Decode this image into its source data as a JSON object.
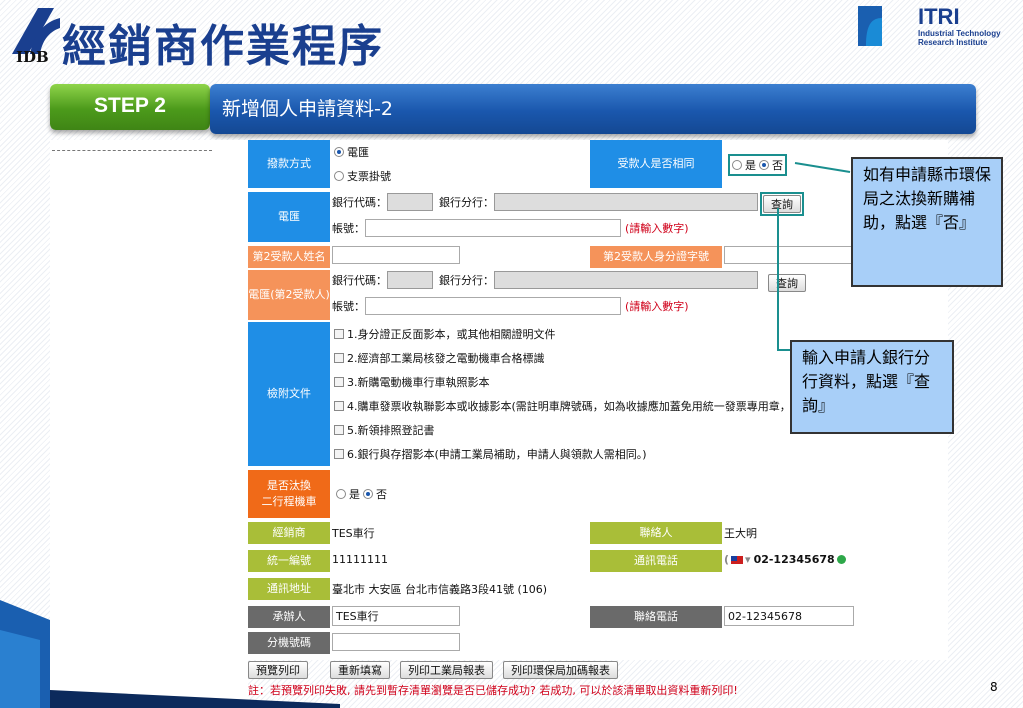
{
  "slide": {
    "title": "經銷商作業程序",
    "idb": "IDB",
    "itri_name": "ITRI",
    "itri_sub1": "Industrial Technology",
    "itri_sub2": "Research Institute",
    "step": "STEP 2",
    "header": "新增個人申請資料-2",
    "page": "8"
  },
  "form": {
    "pay_label": "撥款方式",
    "pay_opt1": "電匯",
    "pay_opt2": "支票掛號",
    "same_label": "受款人是否相同",
    "yes": "是",
    "no": "否",
    "wire_label": "電匯",
    "bank_code": "銀行代碼：",
    "bank_branch": "銀行分行：",
    "query": "查詢",
    "account": "帳號：",
    "num_hint": "(請輸入數字)",
    "payee2_name": "第2受款人姓名",
    "payee2_id": "第2受款人身分證字號",
    "wire2_label": "電匯(第2受款人)",
    "attach_label": "檢附文件",
    "attachments": [
      "1.身分證正反面影本，或其他相關證明文件",
      "2.經濟部工業局核發之電動機車合格標識",
      "3.新購電動機車行車執照影本",
      "4.購車發票收執聯影本或收據影本(需註明車牌號碼，如為收據應加蓋免用統一發票專用章，並",
      "5.新領排照登記書",
      "6.銀行與存摺影本(申請工業局補助，申請人與領款人需相同。)"
    ],
    "scrap_label1": "是否汰換",
    "scrap_label2": "二行程機車",
    "dealer_label": "經銷商",
    "dealer_value": "TES車行",
    "contact_label": "聯絡人",
    "contact_value": "王大明",
    "taxid_label": "統一編號",
    "taxid_value": "11111111",
    "phone_label": "通訊電話",
    "phone_value": "02-12345678",
    "address_label": "通訊地址",
    "address_value": "臺北市 大安區 台北市信義路3段41號 (106)",
    "handler_label": "承辦人",
    "handler_value": "TES車行",
    "handler_phone_label": "聯絡電話",
    "handler_phone_value": "02-12345678",
    "ext_label": "分機號碼",
    "buttons": [
      "預覽列印",
      "重新填寫",
      "列印工業局報表",
      "列印環保局加碼報表"
    ],
    "note": "註：若預覽列印失敗, 請先到暫存清單瀏覽是否已儲存成功? 若成功, 可以於該清單取出資料重新列印!"
  },
  "callouts": {
    "c1": "如有申請縣市環保局之汰換新購補助，點選『否』",
    "c2": "輸入申請人銀行分行資料，點選『查詢』"
  },
  "colors": {
    "header_blue": "#1a57ad",
    "step_green": "#4c9a1b",
    "label_blue": "#1f8ee6",
    "label_orange": "#f5935a",
    "label_olive": "#a9be38",
    "label_gray": "#6a6a6a"
  }
}
